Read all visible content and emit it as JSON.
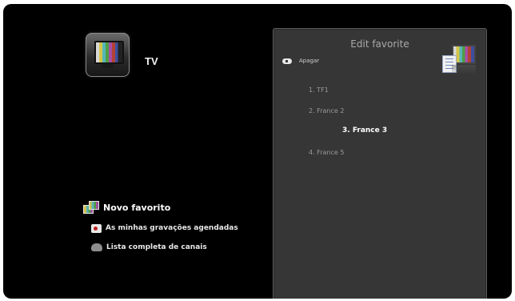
{
  "header": {
    "title": "TV",
    "logo_icon": "tv-icon"
  },
  "menu": {
    "items": [
      {
        "label": "Novo favorito",
        "icon": "favorite-channels-icon",
        "active": true
      },
      {
        "label": "As minhas gravações agendadas",
        "icon": "record-icon",
        "active": false
      },
      {
        "label": "Lista completa de canais",
        "icon": "channel-list-icon",
        "active": false
      }
    ]
  },
  "panel": {
    "title": "Edit favorite",
    "delete_hint": "Apagar",
    "delete_key_icon": "remote-key-icon",
    "corner_icon": "tv-favorites-icon",
    "channels": [
      {
        "label": "1. TF1",
        "selected": false
      },
      {
        "label": "2. France 2",
        "selected": false
      },
      {
        "label": "3. France 3",
        "selected": true
      },
      {
        "label": "4. France 5",
        "selected": false
      }
    ]
  },
  "colors": {
    "background": "#000000",
    "panel": "#363636",
    "text_dim": "#9a9a9a",
    "text_highlight": "#ffffff"
  }
}
